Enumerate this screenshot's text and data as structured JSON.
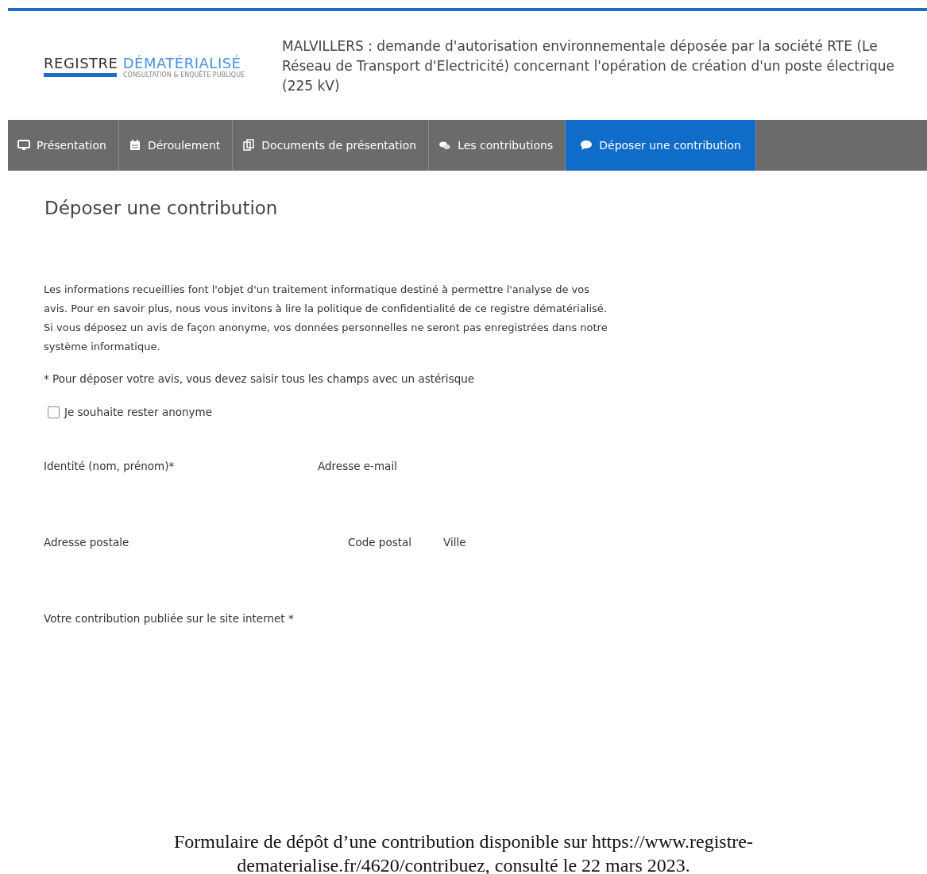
{
  "logo": {
    "title_dark": "REGISTRE",
    "title_light": "DÉMATÉRIALISÉ",
    "tagline": "CONSULTATION & ENQUÊTE PUBLIQUE"
  },
  "page_title": "MALVILLERS : demande d'autorisation environnementale déposée par la société RTE (Le Réseau de Transport d'Electricité) concernant l'opération de création d'un poste électrique (225 kV)",
  "tabs": [
    {
      "label": "Présentation",
      "selected": false
    },
    {
      "label": "Déroulement",
      "selected": false
    },
    {
      "label": "Documents de présentation",
      "selected": false
    },
    {
      "label": "Les contributions",
      "selected": false
    },
    {
      "label": "Déposer une contribution",
      "selected": true
    }
  ],
  "heading": "Déposer une contribution",
  "privacy_notice": "Les informations recueillies font l'objet d'un traitement informatique destiné à permettre l'analyse de vos avis. Pour en savoir plus, nous vous invitons à lire la politique de confidentialité de ce registre dématérialisé. Si vous déposez un avis de façon anonyme, vos données personnelles ne seront pas enregistrées dans notre système informatique.",
  "required_note": "* Pour déposer votre avis, vous devez saisir tous les champs avec un astérisque",
  "anonymous": {
    "label": "Je souhaite rester anonyme",
    "checked": false
  },
  "field_rows": [
    [
      "Identité (nom, prénom)*",
      "Adresse e-mail"
    ],
    [
      "Adresse postale",
      "Code postal",
      "Ville"
    ],
    [
      "Votre contribution publiée sur le site internet *"
    ]
  ],
  "caption": "Formulaire de dépôt d’une contribution disponible sur https://www.registre-dematerialise.fr/4620/contribuez, consulté le 22 mars 2023."
}
